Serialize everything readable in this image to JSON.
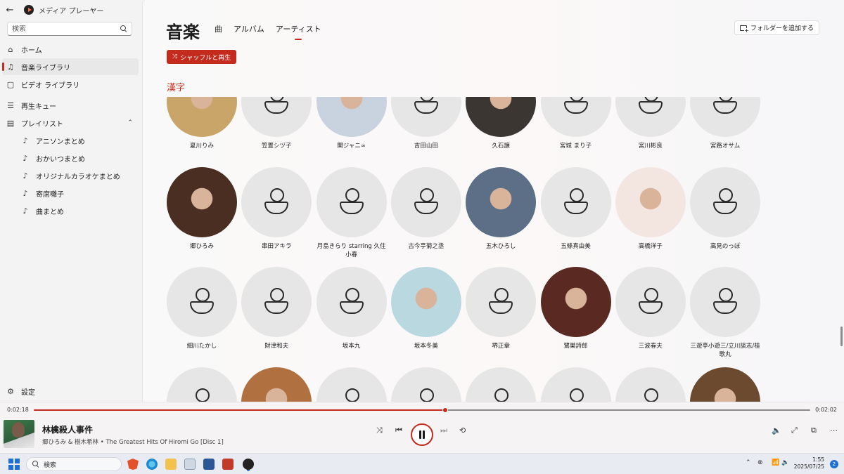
{
  "window": {
    "title": "メディア プレーヤー",
    "back": "←",
    "minimize": "—",
    "restore": "❐",
    "close": "✕"
  },
  "sidebar": {
    "search_placeholder": "検索",
    "items": [
      {
        "label": "ホーム",
        "icon": "⌂"
      },
      {
        "label": "音楽ライブラリ",
        "icon": "♫"
      },
      {
        "label": "ビデオ ライブラリ",
        "icon": "▢"
      },
      {
        "label": "再生キュー",
        "icon": "☰"
      },
      {
        "label": "プレイリスト",
        "icon": "▤"
      }
    ],
    "playlists": [
      {
        "label": "アニソンまとめ",
        "icon": "♪"
      },
      {
        "label": "おかいつまとめ",
        "icon": "♪"
      },
      {
        "label": "オリジナルカラオケまとめ",
        "icon": "♪"
      },
      {
        "label": "寄席囃子",
        "icon": "♪"
      },
      {
        "label": "曲まとめ",
        "icon": "♪"
      }
    ],
    "settings": "設定",
    "settings_icon": "⚙",
    "chevron": "⌃"
  },
  "main": {
    "title": "音楽",
    "tabs": [
      "曲",
      "アルバム",
      "アーティスト"
    ],
    "active_tab": "アーティスト",
    "add_folder": "フォルダーを追加する",
    "shuffle_label": "シャッフルと再生",
    "shuffle_icon": "⤨",
    "section_letter": "漢字",
    "artists": [
      {
        "name": "夏川りみ",
        "photo": true,
        "color": "#c9a56a"
      },
      {
        "name": "笠置シヅ子",
        "photo": false
      },
      {
        "name": "関ジャニ∞",
        "photo": true,
        "color": "#c8d3df"
      },
      {
        "name": "吉田山田",
        "photo": false
      },
      {
        "name": "久石譲",
        "photo": true,
        "color": "#3b3632"
      },
      {
        "name": "宮城 まり子",
        "photo": false
      },
      {
        "name": "宮川彬良",
        "photo": false
      },
      {
        "name": "宮路オサム",
        "photo": false
      },
      {
        "name": "郷ひろみ",
        "photo": true,
        "color": "#4a2e22"
      },
      {
        "name": "串田アキラ",
        "photo": false
      },
      {
        "name": "月島きらり starring 久住小春",
        "photo": false
      },
      {
        "name": "古今亭菊之丞",
        "photo": false
      },
      {
        "name": "五木ひろし",
        "photo": true,
        "color": "#5d6f86"
      },
      {
        "name": "五條真由美",
        "photo": false
      },
      {
        "name": "高橋洋子",
        "photo": true,
        "color": "#f3e6e1"
      },
      {
        "name": "高見のっぽ",
        "photo": false
      },
      {
        "name": "細川たかし",
        "photo": false
      },
      {
        "name": "財津和夫",
        "photo": false
      },
      {
        "name": "坂本九",
        "photo": false
      },
      {
        "name": "坂本冬美",
        "photo": true,
        "color": "#b9d8e0"
      },
      {
        "name": "堺正章",
        "photo": false
      },
      {
        "name": "鷺巣詩郎",
        "photo": true,
        "color": "#5a2a22"
      },
      {
        "name": "三波春夫",
        "photo": false
      },
      {
        "name": "三遊亭小遊三/立川談志/桂歌丸",
        "photo": false
      },
      {
        "name": "",
        "photo": false
      },
      {
        "name": "",
        "photo": true,
        "color": "#b0703f"
      },
      {
        "name": "",
        "photo": false
      },
      {
        "name": "",
        "photo": false
      },
      {
        "name": "",
        "photo": false
      },
      {
        "name": "",
        "photo": false
      },
      {
        "name": "",
        "photo": false
      },
      {
        "name": "",
        "photo": true,
        "color": "#6b4a30"
      }
    ]
  },
  "player": {
    "elapsed": "0:02:18",
    "remaining": "0:02:02",
    "progress": 0.53,
    "track_title": "林檎殺人事件",
    "track_subtitle": "郷ひろみ & 樹木希林 • The Greatest Hits Of Hiromi Go [Disc 1]",
    "shuffle_icon": "⤨",
    "prev_icon": "⏮",
    "next_icon": "⏭",
    "repeat_icon": "⟲",
    "volume_icon": "🔈",
    "fullscreen_icon": "⤢",
    "miniplayer_icon": "⧉",
    "more_icon": "⋯"
  },
  "taskbar": {
    "search_label": "検索",
    "time": "1:55",
    "date": "2025/07/25",
    "notifications": "2",
    "tray_chevron": "⌃",
    "tray_icons": [
      "⊗",
      "📶",
      "🔈",
      "🔋"
    ]
  },
  "colors": {
    "accent": "#c42b1c"
  }
}
